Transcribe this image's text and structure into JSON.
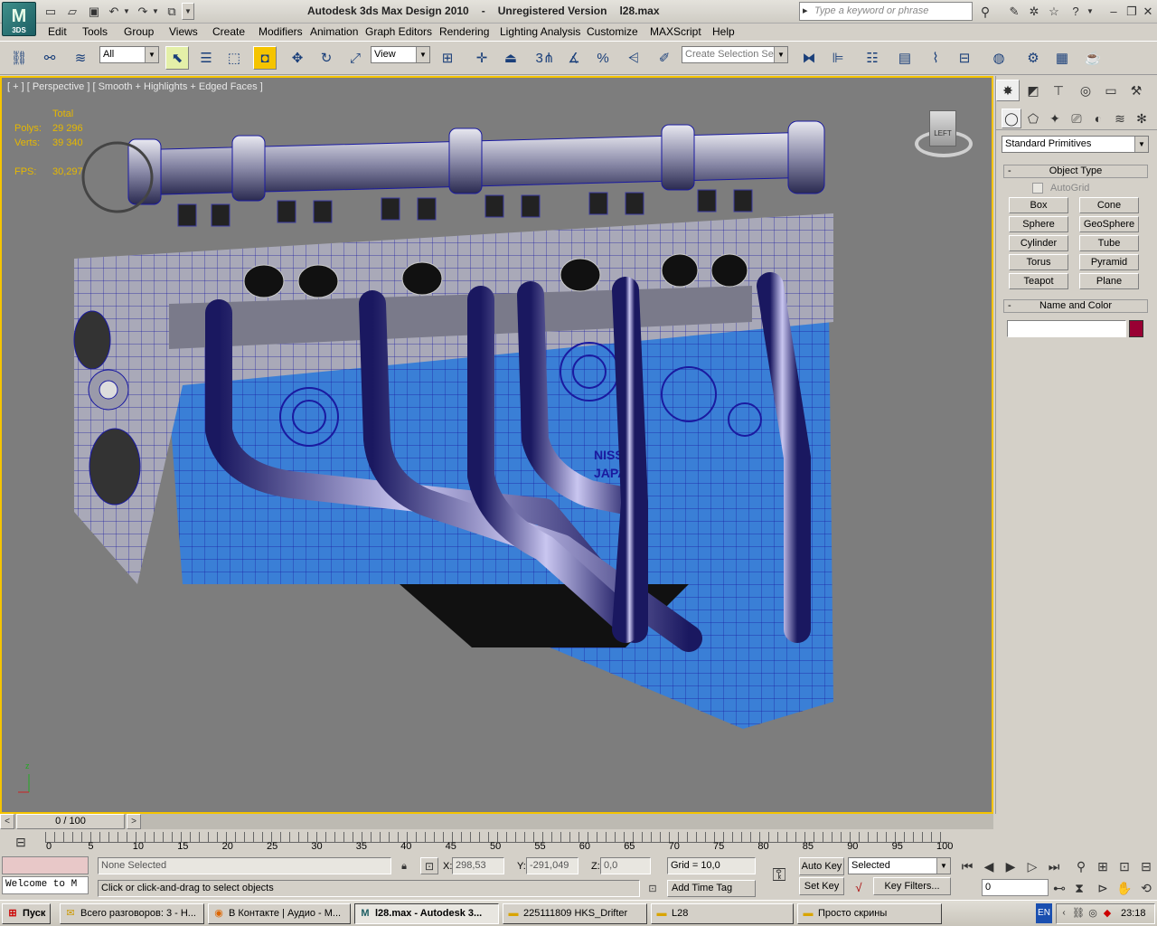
{
  "window": {
    "app_name": "Autodesk 3ds Max Design 2010",
    "license": "Unregistered Version",
    "file_name": "l28.max",
    "logo_text": "M",
    "logo_subtext": "3DS",
    "search_placeholder": "Type a keyword or phrase"
  },
  "menu": [
    "Edit",
    "Tools",
    "Group",
    "Views",
    "Create",
    "Modifiers",
    "Animation",
    "Graph Editors",
    "Rendering",
    "Lighting Analysis",
    "Customize",
    "MAXScript",
    "Help"
  ],
  "toolbar": {
    "selection_filter": "All",
    "ref_coord": "View",
    "snap_angle_label": "3",
    "named_selection_placeholder": "Create Selection Se"
  },
  "viewport": {
    "label": "[ + ] [ Perspective ] [ Smooth + Highlights + Edged Faces ]",
    "stats_header": "Total",
    "polys_label": "Polys:",
    "polys_value": "29 296",
    "verts_label": "Verts:",
    "verts_value": "39 340",
    "fps_label": "FPS:",
    "fps_value": "30,297",
    "viewcube_face": "LEFT",
    "engine_text_1": "NISSA",
    "engine_text_2": "JAPAN",
    "axis_label": "z"
  },
  "command_panel": {
    "category_dropdown": "Standard Primitives",
    "object_type_title": "Object Type",
    "autogrid_label": "AutoGrid",
    "primitives": [
      "Box",
      "Cone",
      "Sphere",
      "GeoSphere",
      "Cylinder",
      "Tube",
      "Torus",
      "Pyramid",
      "Teapot",
      "Plane"
    ],
    "name_color_title": "Name and Color",
    "object_name": "",
    "object_color": "#990033"
  },
  "timeline": {
    "frame_display": "0 / 100",
    "prev_arrow": "<",
    "next_arrow": ">",
    "ticks": [
      "0",
      "5",
      "10",
      "15",
      "20",
      "25",
      "30",
      "35",
      "40",
      "45",
      "50",
      "55",
      "60",
      "65",
      "70",
      "75",
      "80",
      "85",
      "90",
      "95",
      "100"
    ]
  },
  "status": {
    "maxscript_listener": "Welcome to M",
    "selection_status": "None Selected",
    "prompt": "Click or click-and-drag to select objects",
    "x_label": "X:",
    "x_value": "298,53",
    "y_label": "Y:",
    "y_value": "-291,049",
    "z_label": "Z:",
    "z_value": "0,0",
    "grid": "Grid = 10,0",
    "add_time_tag": "Add Time Tag",
    "auto_key": "Auto Key",
    "set_key": "Set Key",
    "key_mode": "Selected",
    "key_filters": "Key Filters...",
    "current_frame": "0"
  },
  "taskbar": {
    "start_label": "Пуск",
    "tasks": [
      "Всего разговоров: 3 - Н...",
      "В Контакте | Аудио - М...",
      "l28.max - Autodesk 3...",
      "225111809 HKS_Drifter",
      "L28",
      "Просто скрины"
    ],
    "language": "EN",
    "clock": "23:18"
  },
  "colors": {
    "viewport_bg": "#7d7d7d",
    "active_border": "#f5c400",
    "stats_text": "#e6b800",
    "mesh_blue": "#3a7fd6",
    "wire": "#1a1aa0"
  }
}
